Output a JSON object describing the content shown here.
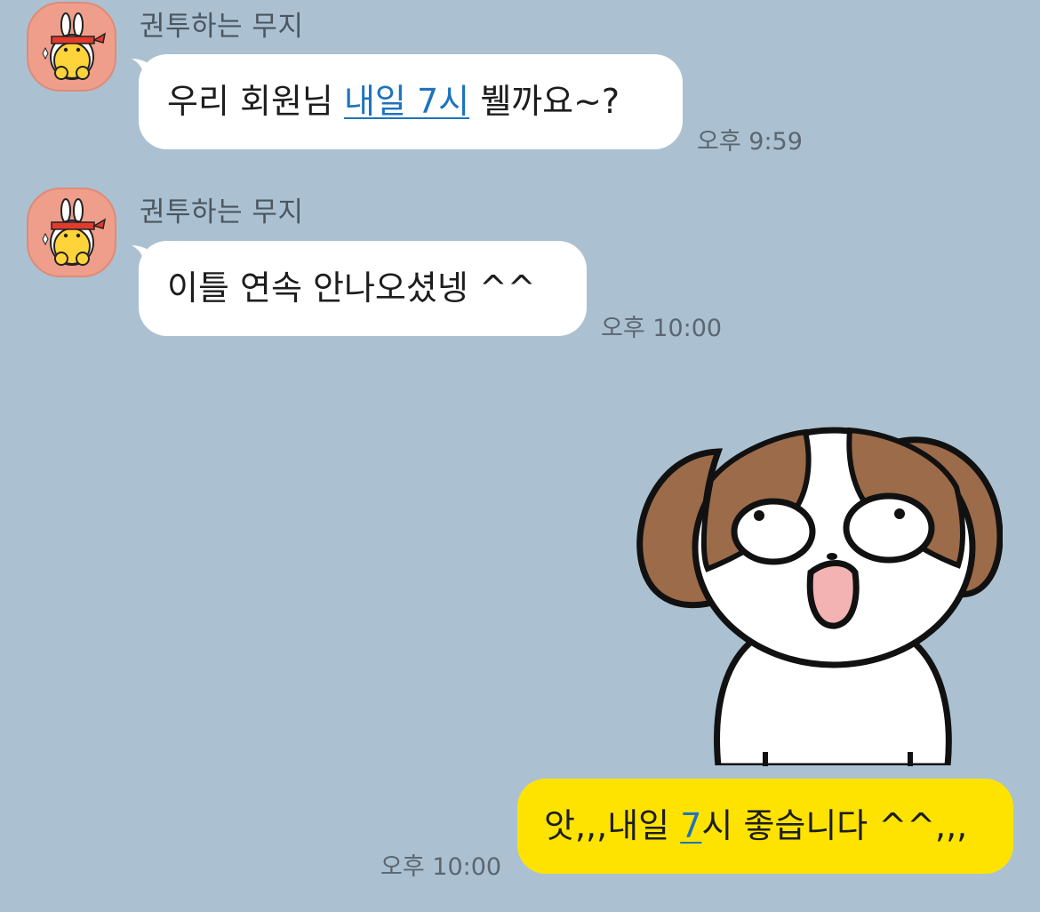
{
  "colors": {
    "background": "#abc1d1",
    "incoming_bubble": "#ffffff",
    "outgoing_bubble": "#ffe300",
    "link": "#1d73bd",
    "timestamp": "#5b6671",
    "sender_name": "#4b5660"
  },
  "messages": [
    {
      "sender": "권투하는 무지",
      "text_before": "우리 회원님 ",
      "link_text": "내일 7시",
      "text_after": " 뷀까요~?",
      "time": "오후 9:59"
    },
    {
      "sender": "권투하는 무지",
      "text": "이틀 연속 안나오셨넹 ^^",
      "time": "오후 10:00"
    }
  ],
  "sticker": {
    "icon": "shih-tzu-puppy-surprised-sticker"
  },
  "reply": {
    "text_before": "앗,,,내일 ",
    "link_text": "7",
    "text_after": "시 좋습니다 ^^,,,",
    "time": "오후 10:00"
  },
  "avatar": {
    "icon": "muzi-boxer-avatar-icon"
  }
}
